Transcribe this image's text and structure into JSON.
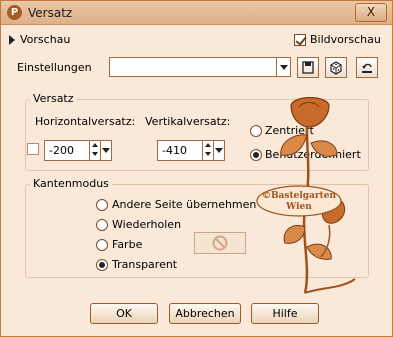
{
  "window": {
    "title": "Versatz",
    "close_label": "X"
  },
  "top": {
    "preview_label": "Vorschau",
    "image_preview_label": "Bildvorschau",
    "image_preview_checked": true,
    "settings_label": "Einstellungen",
    "settings_value": ""
  },
  "offset": {
    "group_title": "Versatz",
    "horizontal_label": "Horizontalversatz:",
    "horizontal_value": "-200",
    "vertical_label": "Vertikalversatz:",
    "vertical_value": "-410",
    "centered_label": "Zentriert",
    "custom_label": "Benutzerdefiniert",
    "selected": "custom"
  },
  "edge": {
    "group_title": "Kantenmodus",
    "options": [
      "Andere Seite übernehmen",
      "Wiederholen",
      "Farbe",
      "Transparent"
    ],
    "selected": "Transparent"
  },
  "watermark": {
    "line1": "©Bastelgarten",
    "line2": "Wien"
  },
  "buttons": {
    "ok": "OK",
    "cancel": "Abbrechen",
    "help": "Hilfe"
  },
  "colors": {
    "accent": "#a0521a",
    "window_bg": "#fae9d8"
  }
}
